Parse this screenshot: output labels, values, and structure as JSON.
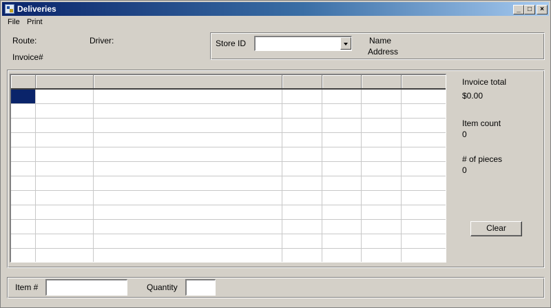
{
  "window": {
    "title": "Deliveries",
    "minimize": "_",
    "maximize": "□",
    "close": "×"
  },
  "menu": [
    "File",
    "Print"
  ],
  "header": {
    "route_label": "Route:",
    "driver_label": "Driver:",
    "invoice_label": "Invoice#",
    "store_id_label": "Store ID",
    "store_id_value": "",
    "name_label": "Name",
    "address_label": "Address"
  },
  "summary": {
    "invoice_total_label": "Invoice total",
    "invoice_total_value": "$0.00",
    "item_count_label": "Item count",
    "item_count_value": "0",
    "pieces_label": "# of pieces",
    "pieces_value": "0",
    "clear_button": "Clear"
  },
  "grid": {
    "column_headers": [
      "",
      "",
      "",
      "",
      "",
      "",
      ""
    ],
    "row_count": 12
  },
  "entry": {
    "item_label": "Item #",
    "item_value": "",
    "quantity_label": "Quantity",
    "quantity_value": ""
  }
}
